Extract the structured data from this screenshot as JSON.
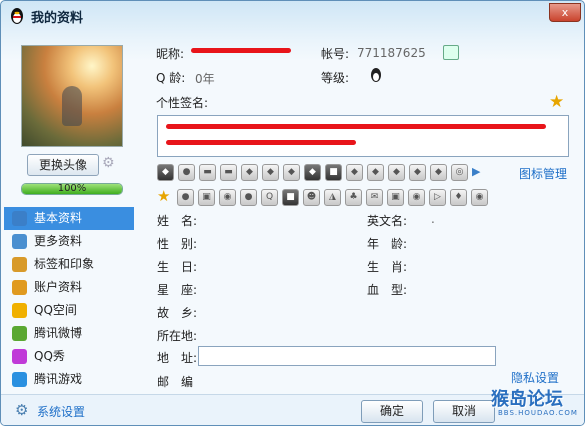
{
  "window": {
    "title": "我的资料",
    "close_label": "x"
  },
  "left": {
    "change_avatar": "更换头像",
    "progress": {
      "value": 1.0,
      "label": "100%"
    },
    "nav": [
      {
        "label": "基本资料",
        "icon": "profile-card-icon",
        "color": "#3b7fc8"
      },
      {
        "label": "更多资料",
        "icon": "more-info-icon",
        "color": "#4a8fd0"
      },
      {
        "label": "标签和印象",
        "icon": "tag-icon",
        "color": "#d89a2a"
      },
      {
        "label": "账户资料",
        "icon": "account-icon",
        "color": "#e09a20"
      },
      {
        "label": "QQ空间",
        "icon": "star-icon",
        "color": "#f0b000"
      },
      {
        "label": "腾讯微博",
        "icon": "weibo-icon",
        "color": "#5aa832"
      },
      {
        "label": "QQ秀",
        "icon": "qqshow-icon",
        "color": "#c03ad8"
      },
      {
        "label": "腾讯游戏",
        "icon": "game-icon",
        "color": "#2a90e0"
      }
    ],
    "settings": "系统设置"
  },
  "main": {
    "nickname_label": "昵称:",
    "account_label": "帐号:",
    "account_value": "771187625",
    "qage_label": "Q 龄:",
    "qage_value": "0年",
    "level_label": "等级:",
    "signature_label": "个性签名:",
    "icon_manage": "图标管理",
    "fields": {
      "name": "姓　名:",
      "english_name": "英文名:",
      "english_name_value": ".",
      "gender": "性　别:",
      "age": "年　龄:",
      "birthday": "生　日:",
      "zodiac": "生　肖:",
      "constellation": "星　座:",
      "blood": "血　型:",
      "hometown": "故　乡:",
      "location": "所在地:",
      "address": "地　址:",
      "postcode": "邮　编"
    },
    "privacy": "隐私设置"
  },
  "footer": {
    "ok": "确定",
    "cancel": "取消"
  },
  "watermark": {
    "text": "猴岛论坛",
    "sub": "BBS.HOUDAO.COM"
  }
}
